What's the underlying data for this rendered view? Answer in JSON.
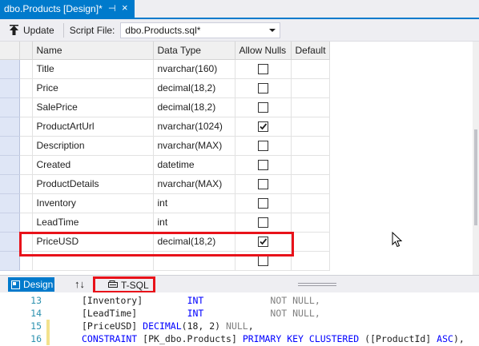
{
  "tab": {
    "title": "dbo.Products [Design]*",
    "pin_glyph": "⊣",
    "close_glyph": "×"
  },
  "toolbar": {
    "update_label": "Update",
    "script_file_label": "Script File:",
    "script_file_value": "dbo.Products.sql*",
    "update_icon": "update-arrow-icon",
    "dropdown_icon": "chevron-down-icon"
  },
  "grid": {
    "columns": [
      "Name",
      "Data Type",
      "Allow Nulls",
      "Default"
    ],
    "rows": [
      {
        "name": "Title",
        "type": "nvarchar(160)",
        "allow_nulls": false,
        "default": ""
      },
      {
        "name": "Price",
        "type": "decimal(18,2)",
        "allow_nulls": false,
        "default": ""
      },
      {
        "name": "SalePrice",
        "type": "decimal(18,2)",
        "allow_nulls": false,
        "default": ""
      },
      {
        "name": "ProductArtUrl",
        "type": "nvarchar(1024)",
        "allow_nulls": true,
        "default": ""
      },
      {
        "name": "Description",
        "type": "nvarchar(MAX)",
        "allow_nulls": false,
        "default": ""
      },
      {
        "name": "Created",
        "type": "datetime",
        "allow_nulls": false,
        "default": ""
      },
      {
        "name": "ProductDetails",
        "type": "nvarchar(MAX)",
        "allow_nulls": false,
        "default": ""
      },
      {
        "name": "Inventory",
        "type": "int",
        "allow_nulls": false,
        "default": ""
      },
      {
        "name": "LeadTime",
        "type": "int",
        "allow_nulls": false,
        "default": ""
      },
      {
        "name": "PriceUSD",
        "type": "decimal(18,2)",
        "allow_nulls": true,
        "default": ""
      },
      {
        "name": "",
        "type": "",
        "allow_nulls": false,
        "default": ""
      }
    ]
  },
  "pane_tabs": {
    "design_label": "Design",
    "swap_label": "↑↓",
    "tsql_label": "T-SQL"
  },
  "code": {
    "lines": [
      {
        "num": "13",
        "parts": [
          [
            "",
            "[Inventory]        "
          ],
          [
            "kw",
            "INT"
          ],
          [
            "gr",
            "            NOT NULL,"
          ]
        ],
        "changed": "saved"
      },
      {
        "num": "14",
        "parts": [
          [
            "",
            "[LeadTime]         "
          ],
          [
            "kw",
            "INT"
          ],
          [
            "gr",
            "            NOT NULL,"
          ]
        ],
        "changed": "saved"
      },
      {
        "num": "15",
        "parts": [
          [
            "",
            "[PriceUSD] "
          ],
          [
            "kw",
            "DECIMAL"
          ],
          [
            "",
            "(18, 2) "
          ],
          [
            "gr",
            "NULL"
          ],
          [
            "",
            ","
          ]
        ],
        "changed": "unsaved"
      },
      {
        "num": "16",
        "parts": [
          [
            "kw",
            "CONSTRAINT"
          ],
          [
            "",
            " [PK_dbo.Products] "
          ],
          [
            "kw",
            "PRIMARY KEY CLUSTERED"
          ],
          [
            "",
            " ([ProductId] "
          ],
          [
            "kw",
            "ASC"
          ],
          [
            "",
            "),"
          ]
        ],
        "changed": "unsaved"
      }
    ]
  },
  "colors": {
    "accent": "#007acc",
    "highlight": "#e8121a"
  }
}
